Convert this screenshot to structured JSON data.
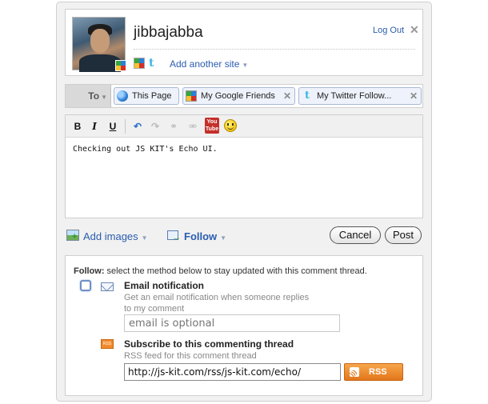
{
  "profile": {
    "username": "jibbajabba",
    "logout_label": "Log Out",
    "close_glyph": "✕",
    "add_site_label": "Add another site",
    "connected_sites": [
      "google-icon",
      "twitter-icon"
    ]
  },
  "to_row": {
    "to_label": "To",
    "recipients": [
      {
        "label": "This Page",
        "icon": "globe-icon",
        "removable": false
      },
      {
        "label": "My Google Friends",
        "icon": "google-icon",
        "removable": true
      },
      {
        "label": "My Twitter Follow...",
        "icon": "twitter-icon",
        "removable": true
      }
    ]
  },
  "editor": {
    "toolbar": {
      "bold": "B",
      "italic": "I",
      "underline": "U",
      "youtube_top": "You",
      "youtube_bottom": "Tube"
    },
    "text": "Checking out JS KIT's Echo UI."
  },
  "actions": {
    "add_images_label": "Add images",
    "follow_label": "Follow",
    "cancel_label": "Cancel",
    "post_label": "Post"
  },
  "follow_panel": {
    "intro_bold": "Follow:",
    "intro_text": " select the method below to stay updated with this comment thread.",
    "email": {
      "title": "Email notification",
      "desc_line1": "Get an email notification when someone replies",
      "desc_line2": "to my comment",
      "placeholder": "email is optional",
      "checked": false
    },
    "rss": {
      "title": "Subscribe to this commenting thread",
      "desc": "RSS feed for this comment thread",
      "url": "http://js-kit.com/rss/js-kit.com/echo/",
      "button_label": "RSS",
      "small_icon_text": "RSS"
    }
  },
  "colors": {
    "link": "#2a5db0",
    "rss_orange": "#e2761b",
    "panel_bg": "#f1f1f1"
  }
}
